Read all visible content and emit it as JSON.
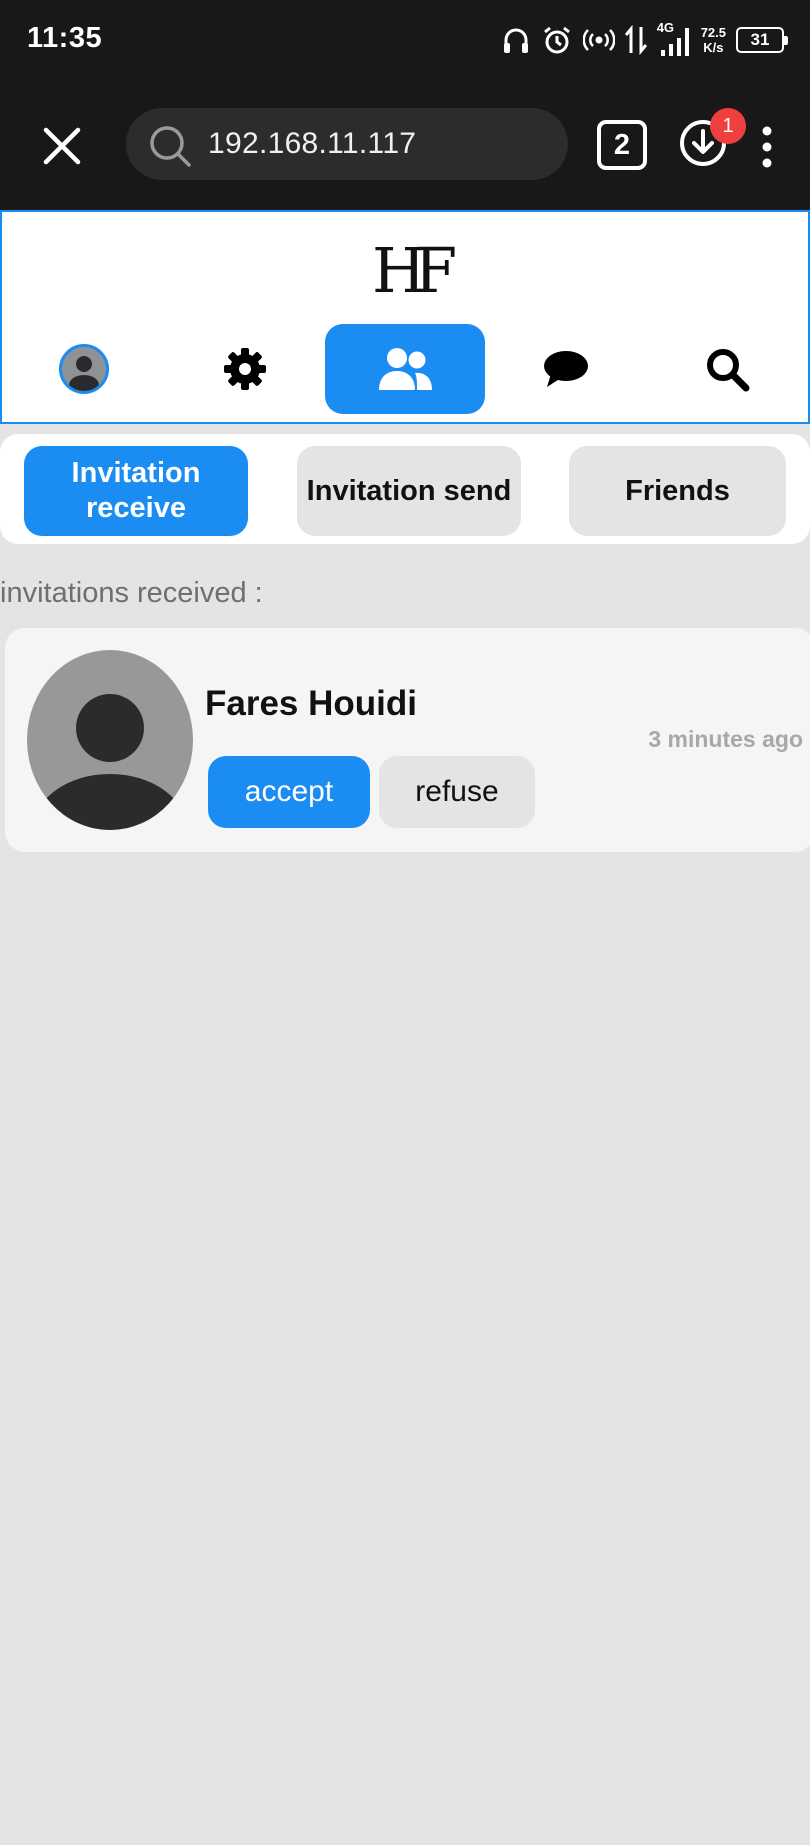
{
  "status_bar": {
    "time": "11:35",
    "network_label": "4G",
    "speed_value": "72.5",
    "speed_unit": "K/s",
    "battery": "31",
    "icons": [
      "headphones-icon",
      "alarm-icon",
      "hotspot-icon",
      "data-transfer-icon",
      "signal-icon",
      "battery-icon"
    ]
  },
  "browser": {
    "url": "192.168.11.117",
    "tab_count": "2",
    "download_badge": "1"
  },
  "app": {
    "logo": "HF",
    "accent_color": "#1a8cf2",
    "nav": [
      {
        "name": "profile",
        "icon": "avatar-icon",
        "active": false
      },
      {
        "name": "settings",
        "icon": "gear-icon",
        "active": false
      },
      {
        "name": "friends",
        "icon": "users-icon",
        "active": true
      },
      {
        "name": "messages",
        "icon": "chat-bubble-icon",
        "active": false
      },
      {
        "name": "search",
        "icon": "search-icon",
        "active": false
      }
    ],
    "tabs": {
      "invitation_receive": "Invitation receive",
      "invitation_send": "Invitation send",
      "friends": "Friends",
      "active": "invitation_receive"
    },
    "section_label": "invitations received :",
    "invitations": [
      {
        "name": "Fares Houidi",
        "time": "3 minutes ago",
        "accept_label": "accept",
        "refuse_label": "refuse"
      }
    ]
  }
}
